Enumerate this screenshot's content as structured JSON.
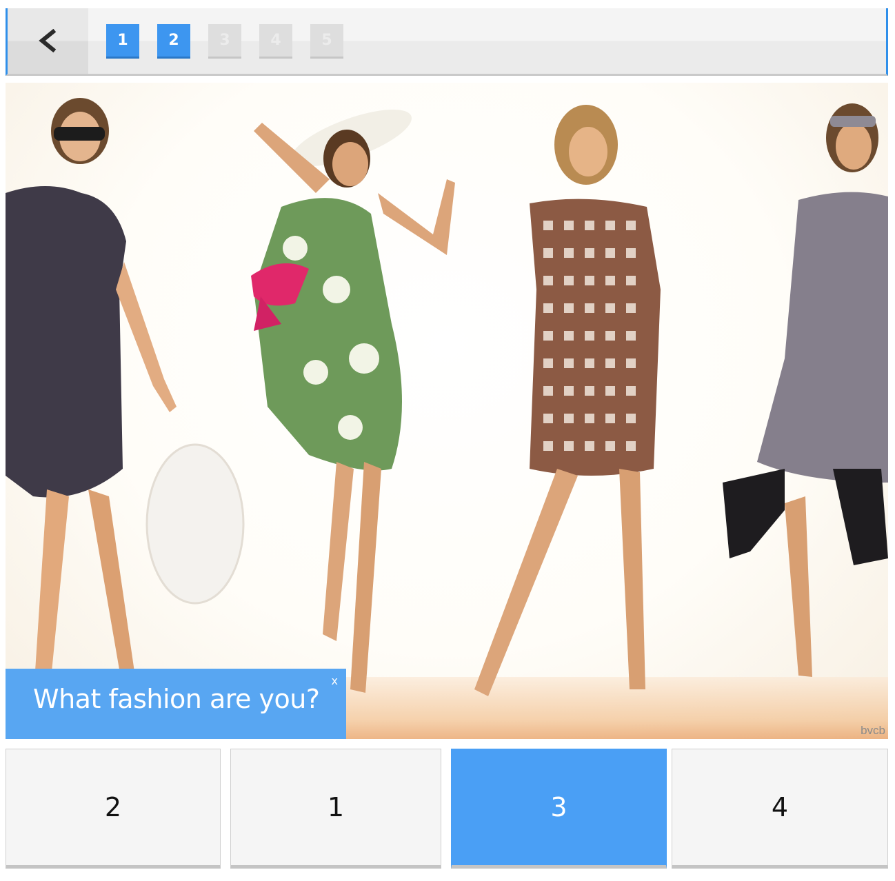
{
  "nav": {
    "back_icon": "chevron-left-icon",
    "pages": [
      {
        "label": "1",
        "state": "active"
      },
      {
        "label": "2",
        "state": "active"
      },
      {
        "label": "3",
        "state": "disabled"
      },
      {
        "label": "4",
        "state": "disabled"
      },
      {
        "label": "5",
        "state": "disabled"
      }
    ]
  },
  "photo": {
    "credit": "bvcb"
  },
  "caption": {
    "text": "What fashion are you?",
    "close_label": "x"
  },
  "options": [
    {
      "label": "2",
      "selected": false
    },
    {
      "label": "1",
      "selected": false
    },
    {
      "label": "3",
      "selected": true
    },
    {
      "label": "4",
      "selected": false
    }
  ],
  "colors": {
    "accent": "#3d96f0",
    "caption_bg": "#58a6f2",
    "selected_option": "#4a9ff5"
  }
}
